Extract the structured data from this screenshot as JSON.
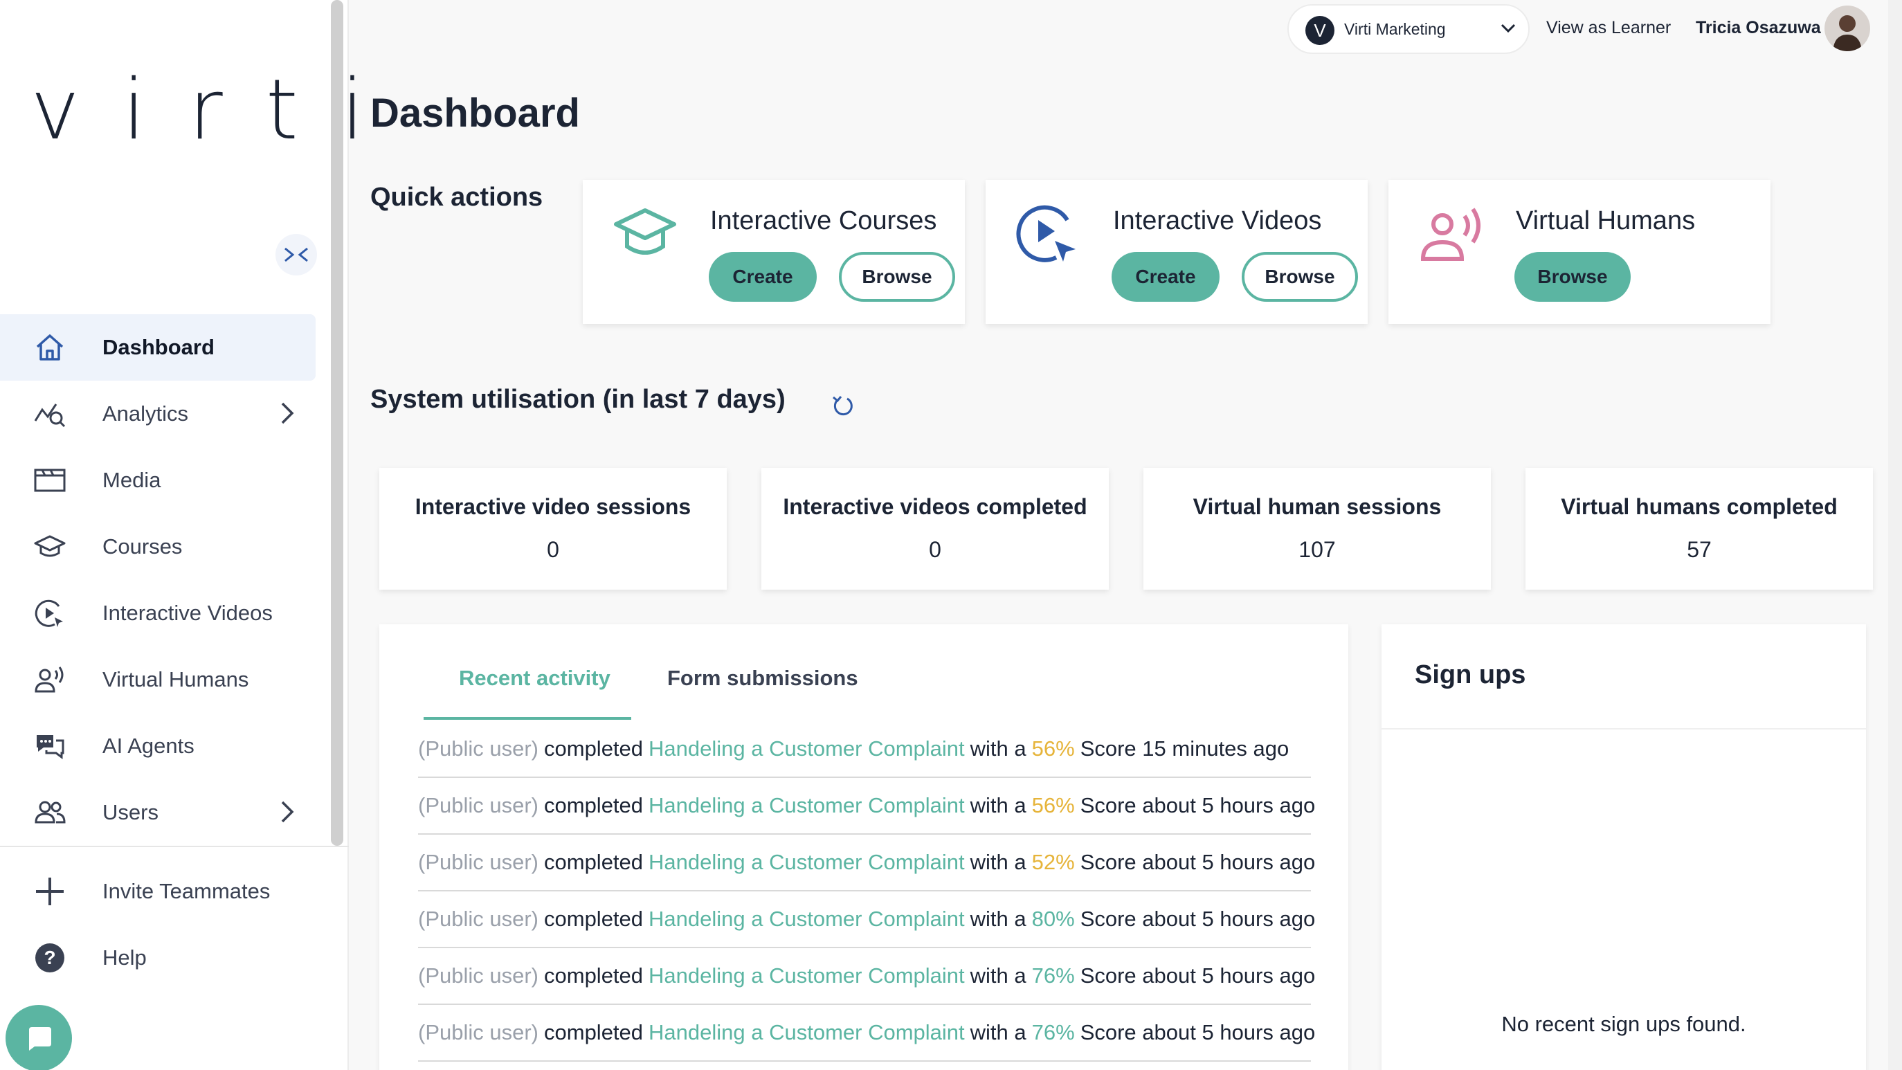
{
  "sidebar": {
    "logo": "virti",
    "items": [
      {
        "label": "Dashboard",
        "icon": "home-icon",
        "active": true
      },
      {
        "label": "Analytics",
        "icon": "analytics-icon",
        "has_submenu": true
      },
      {
        "label": "Media",
        "icon": "media-icon"
      },
      {
        "label": "Courses",
        "icon": "courses-icon"
      },
      {
        "label": "Interactive Videos",
        "icon": "interactive-video-icon"
      },
      {
        "label": "Virtual Humans",
        "icon": "virtual-human-icon"
      },
      {
        "label": "AI Agents",
        "icon": "ai-agents-icon"
      },
      {
        "label": "Users",
        "icon": "users-icon",
        "has_submenu": true
      }
    ],
    "bottom_items": [
      {
        "label": "Invite Teammates",
        "icon": "plus-icon"
      },
      {
        "label": "Help",
        "icon": "help-icon"
      }
    ]
  },
  "topbar": {
    "org_initial": "V",
    "org_name": "Virti Marketing",
    "view_as_learner": "View as Learner",
    "user_name": "Tricia Osazuwa"
  },
  "main": {
    "title": "Dashboard",
    "quick_actions": {
      "title": "Quick actions",
      "cards": [
        {
          "title": "Interactive Courses",
          "create": "Create",
          "browse": "Browse"
        },
        {
          "title": "Interactive Videos",
          "create": "Create",
          "browse": "Browse"
        },
        {
          "title": "Virtual Humans",
          "browse": "Browse"
        }
      ]
    },
    "utilisation": {
      "title": "System utilisation (in last 7 days)",
      "stats": [
        {
          "label": "Interactive video sessions",
          "value": "0"
        },
        {
          "label": "Interactive videos completed",
          "value": "0"
        },
        {
          "label": "Virtual human sessions",
          "value": "107"
        },
        {
          "label": "Virtual humans completed",
          "value": "57"
        }
      ]
    },
    "activity": {
      "tabs": [
        "Recent activity",
        "Form submissions"
      ],
      "rows": [
        {
          "user": "(Public user)",
          "verb": "completed",
          "course": "Handeling a Customer Complaint",
          "with": "with a",
          "score": "56%",
          "tail": "Score 15 minutes ago"
        },
        {
          "user": "(Public user)",
          "verb": "completed",
          "course": "Handeling a Customer Complaint",
          "with": "with a",
          "score": "56%",
          "tail": "Score about 5 hours ago"
        },
        {
          "user": "(Public user)",
          "verb": "completed",
          "course": "Handeling a Customer Complaint",
          "with": "with a",
          "score": "52%",
          "tail": "Score about 5 hours ago"
        },
        {
          "user": "(Public user)",
          "verb": "completed",
          "course": "Handeling a Customer Complaint",
          "with": "with a",
          "score": "80%",
          "tail": "Score about 5 hours ago"
        },
        {
          "user": "(Public user)",
          "verb": "completed",
          "course": "Handeling a Customer Complaint",
          "with": "with a",
          "score": "76%",
          "tail": "Score about 5 hours ago"
        },
        {
          "user": "(Public user)",
          "verb": "completed",
          "course": "Handeling a Customer Complaint",
          "with": "with a",
          "score": "76%",
          "tail": "Score about 5 hours ago"
        }
      ]
    },
    "signups": {
      "title": "Sign ups",
      "empty": "No recent sign ups found."
    }
  },
  "colors": {
    "accent": "#5bb5a2",
    "score_warn": "#e6b43a",
    "text": "#1c2434",
    "muted": "#9aa0aa",
    "virtual_human_icon": "#d87aa0",
    "interactive_video_icon": "#2f5aa8"
  }
}
